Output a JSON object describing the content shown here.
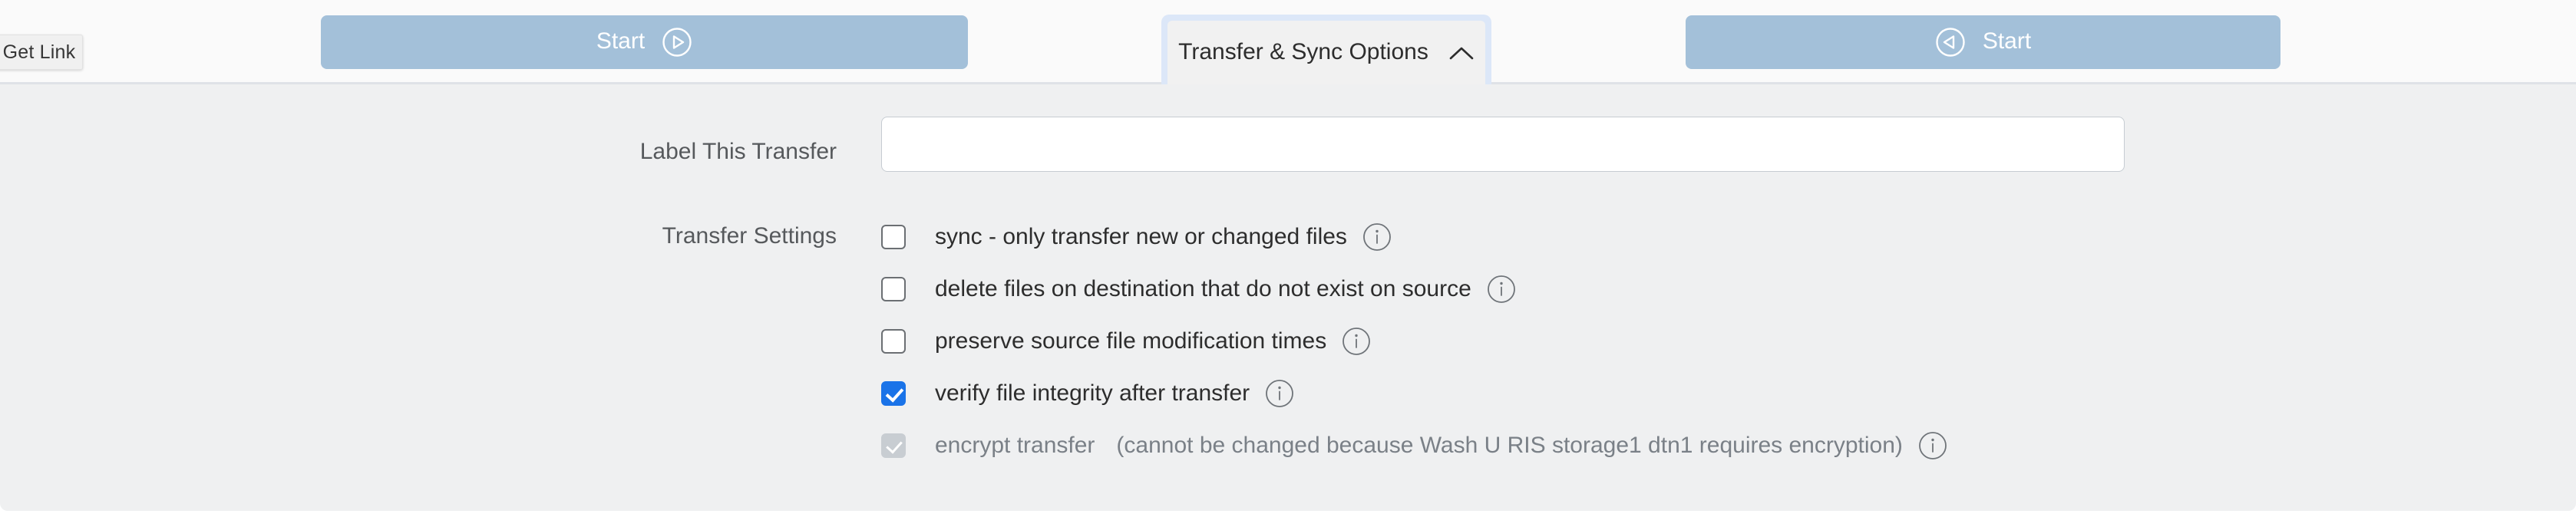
{
  "toolbar": {
    "get_link_label": "Get Link",
    "start_left": {
      "label": "Start",
      "icon": "play-circle-right-icon"
    },
    "sync_tab": {
      "label": "Transfer & Sync Options",
      "icon": "chevron-up-icon",
      "expanded": true
    },
    "start_right": {
      "label": "Start",
      "icon": "play-circle-left-icon"
    },
    "button_color": "#a3c0d9",
    "focus_ring_color": "#dce7f8"
  },
  "form": {
    "label_transfer": "Label This Transfer",
    "label_settings": "Transfer Settings",
    "transfer_name": {
      "value": "",
      "placeholder": ""
    },
    "options": [
      {
        "label": "sync - only transfer new or changed files",
        "checked": false,
        "disabled": false,
        "note": "",
        "info_icon": "info-circle-icon"
      },
      {
        "label": "delete files on destination that do not exist on source",
        "checked": false,
        "disabled": false,
        "note": "",
        "info_icon": "info-circle-icon"
      },
      {
        "label": "preserve source file modification times",
        "checked": false,
        "disabled": false,
        "note": "",
        "info_icon": "info-circle-icon"
      },
      {
        "label": "verify file integrity after transfer",
        "checked": true,
        "disabled": false,
        "note": "",
        "info_icon": "info-circle-icon"
      },
      {
        "label": "encrypt transfer",
        "checked": true,
        "disabled": true,
        "note": "(cannot be changed because Wash U RIS storage1 dtn1 requires encryption)",
        "info_icon": "info-circle-icon"
      }
    ]
  },
  "colors": {
    "accent_blue": "#1a73e8",
    "panel_background": "#eff0f1",
    "toolbar_background": "#fafafa",
    "disabled_gray": "#c8cdd2"
  }
}
